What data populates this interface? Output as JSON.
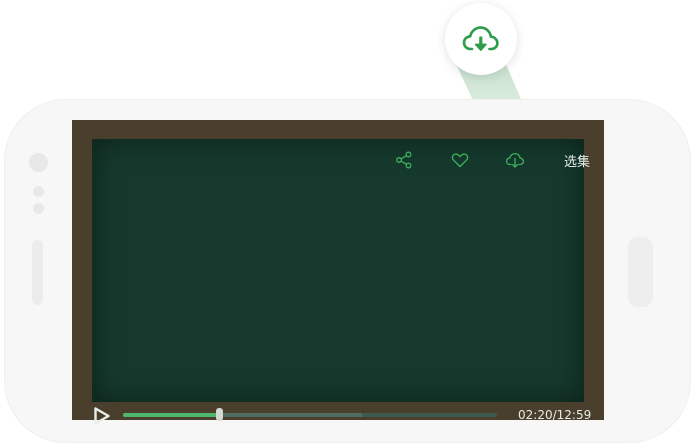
{
  "player": {
    "episodes_label": "选集",
    "time_current": "02:20",
    "time_separator": "/",
    "time_total": "12:59",
    "progress_fraction": 0.258,
    "buffered_fraction": 0.64
  },
  "toolbar": {
    "icons": [
      "share-icon",
      "heart-icon",
      "cloud-download-icon"
    ]
  },
  "callout": {
    "icon": "cloud-download-icon"
  },
  "colors": {
    "accent": "#33a852",
    "board": "#153a2d",
    "frame": "#4a3f2c"
  }
}
